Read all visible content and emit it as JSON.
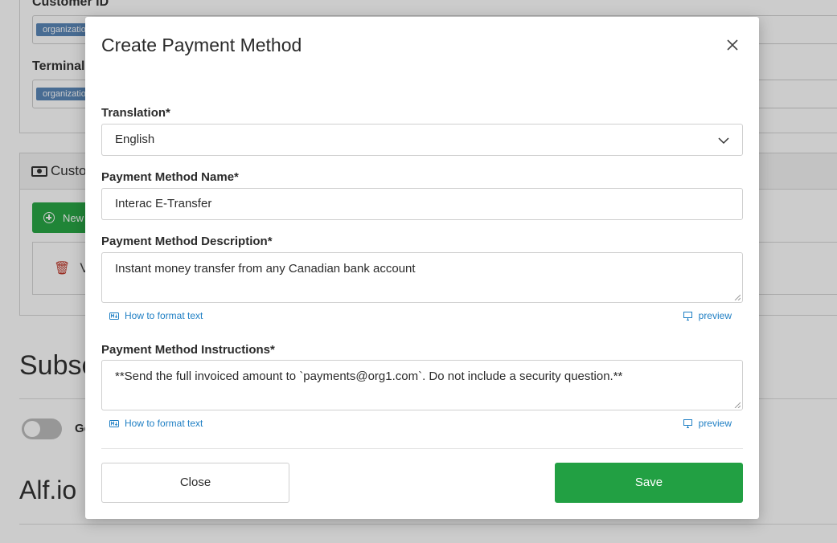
{
  "background": {
    "customer_id_label": "Customer ID",
    "terminal_label": "Terminal I",
    "tag_text": "organizatio",
    "section_header": "Custo",
    "new_button": "New",
    "card_text": "Ve",
    "subscriptions_heading": "Subsc",
    "toggle_label": "Ge",
    "alfio_heading": "Alf.io I"
  },
  "modal": {
    "title": "Create Payment Method",
    "translation": {
      "label": "Translation*",
      "value": "English"
    },
    "name": {
      "label": "Payment Method Name*",
      "value": "Interac E-Transfer"
    },
    "description": {
      "label": "Payment Method Description*",
      "value": "Instant money transfer from any Canadian bank account",
      "format_help": "How to format text",
      "preview": "preview"
    },
    "instructions": {
      "label": "Payment Method Instructions*",
      "value": "**Send the full invoiced amount to `payments@org1.com`. Do not include a security question.**",
      "format_help": "How to format text",
      "preview": "preview"
    },
    "close_label": "Close",
    "save_label": "Save"
  },
  "colors": {
    "primary_green": "#22a043",
    "link_blue": "#1f7fc4",
    "tag_blue": "#5b87b8"
  }
}
